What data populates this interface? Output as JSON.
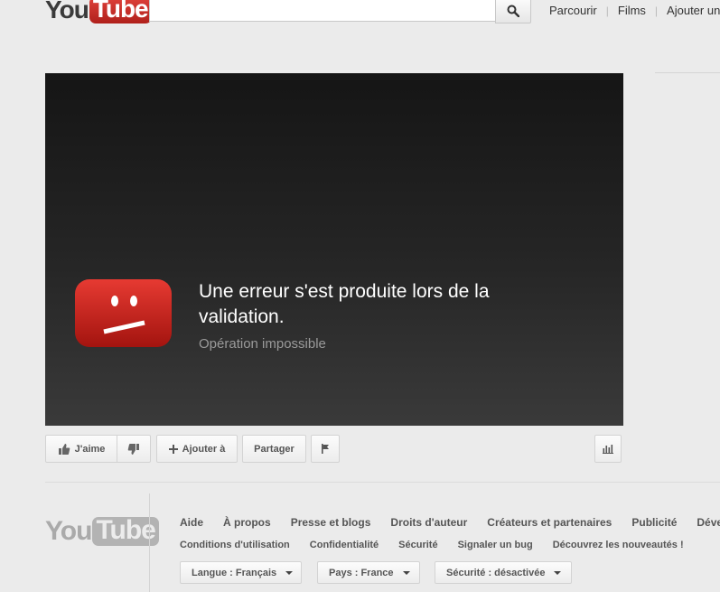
{
  "header": {
    "logo_you": "You",
    "logo_tube": "Tube",
    "search_value": "",
    "search_placeholder": "",
    "nav": [
      "Parcourir",
      "Films",
      "Ajouter un"
    ]
  },
  "player": {
    "error_title": "Une erreur s'est produite lors de la validation.",
    "error_subtitle": "Opération impossible"
  },
  "actions": {
    "like_label": "J'aime",
    "add_label": "Ajouter à",
    "share_label": "Partager"
  },
  "footer": {
    "logo_you": "You",
    "logo_tube": "Tube",
    "main_links": [
      "Aide",
      "À propos",
      "Presse et blogs",
      "Droits d'auteur",
      "Créateurs et partenaires",
      "Publicité",
      "Déve"
    ],
    "sub_links": [
      "Conditions d'utilisation",
      "Confidentialité",
      "Sécurité",
      "Signaler un bug",
      "Découvrez les nouveautés !"
    ],
    "language": "Langue : Français",
    "country": "Pays : France",
    "safety": "Sécurité : désactivée"
  },
  "colors": {
    "brand_red": "#c4302b",
    "player_bg": "#1a1a1a",
    "page_bg": "#ebebeb"
  }
}
